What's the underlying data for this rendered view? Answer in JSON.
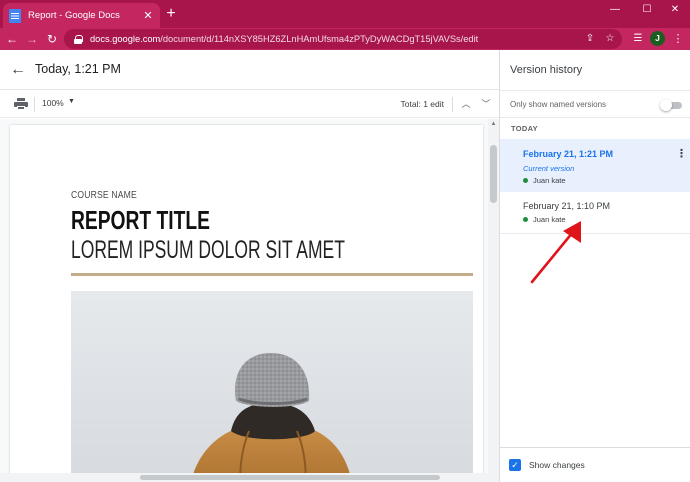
{
  "browser": {
    "tab_title": "Report - Google Docs",
    "tab_close": "✕",
    "new_tab": "+",
    "url_domain": "docs.google.com",
    "url_path": "/document/d/114nXSY85HZ6ZLnHAmUfsma4zPTyDyWACDgT15jVAVSs/edit",
    "minimize": "—",
    "maximize": "☐",
    "close": "✕",
    "back": "←",
    "forward": "→",
    "reload": "↻",
    "avatar_letter": "J",
    "menu": "⋮",
    "share": "⇪",
    "bookmark": "☆",
    "reading_list": "☰"
  },
  "header": {
    "back": "←",
    "title": "Today, 1:21 PM"
  },
  "doc_toolbar": {
    "zoom": "100%",
    "zoom_caret": "▼",
    "total": "Total: 1 edit",
    "prev": "︿",
    "next": "﹀"
  },
  "document": {
    "course": "COURSE NAME",
    "title": "REPORT TITLE",
    "subtitle": "LOREM IPSUM DOLOR SIT AMET"
  },
  "version_history": {
    "title": "Version history",
    "toggle_label": "Only show named versions",
    "toggle_on": false,
    "section": "TODAY",
    "items": [
      {
        "date": "February 21, 1:21 PM",
        "note": "Current version",
        "user": "Juan kate",
        "selected": true
      },
      {
        "date": "February 21, 1:10 PM",
        "user": "Juan kate",
        "selected": false
      }
    ],
    "more": "⋮",
    "show_changes": "Show changes",
    "show_changes_checked": true,
    "check": "✓"
  },
  "colors": {
    "chrome": "#a8154b",
    "toolbar": "#c4265f",
    "accent": "#1a73e8",
    "selected_bg": "#e8f0fe",
    "user_dot": "#1e8e3e",
    "annotation": "#e0141b"
  }
}
